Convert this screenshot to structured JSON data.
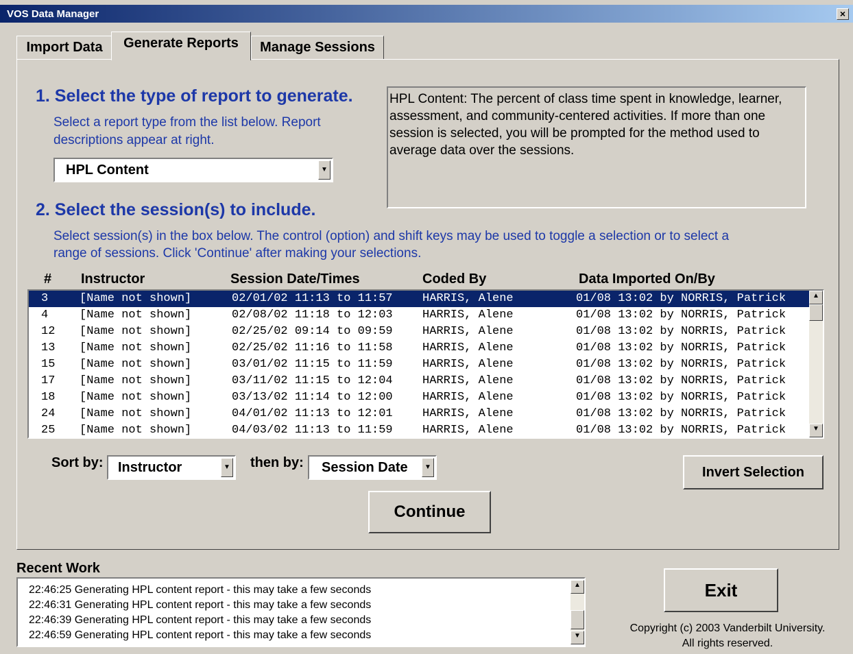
{
  "window": {
    "title": "VOS Data Manager",
    "close_label": "×"
  },
  "tabs": [
    {
      "label": "Import Data"
    },
    {
      "label": "Generate Reports"
    },
    {
      "label": "Manage Sessions"
    }
  ],
  "step1": {
    "heading": "1. Select the type of report to generate.",
    "instruction_line1": "Select a report type from the list below.  Report",
    "instruction_line2": "descriptions appear at right.",
    "report_type_selected": "HPL Content"
  },
  "description": "HPL Content: The percent of class time spent in knowledge, learner, assessment, and community-centered activities.  If more than one session is selected, you will be prompted for the method used to average data over the sessions.",
  "step2": {
    "heading": "2. Select the session(s) to include.",
    "instruction_line1": "Select session(s) in the box below.  The control (option) and shift keys may be used to toggle a selection or to select a",
    "instruction_line2": "range of sessions.  Click 'Continue' after making your selections."
  },
  "session_table": {
    "columns": [
      "#",
      "Instructor",
      "Session Date/Times",
      "Coded By",
      "Data Imported On/By"
    ],
    "rows": [
      {
        "num": "3",
        "instructor": "[Name not shown]",
        "datetime": "02/01/02 11:13 to 11:57",
        "coded_by": "HARRIS, Alene",
        "imported": "01/08 13:02 by NORRIS, Patrick",
        "selected": true
      },
      {
        "num": "4",
        "instructor": "[Name not shown]",
        "datetime": "02/08/02 11:18 to 12:03",
        "coded_by": "HARRIS, Alene",
        "imported": "01/08 13:02 by NORRIS, Patrick",
        "selected": false
      },
      {
        "num": "12",
        "instructor": "[Name not shown]",
        "datetime": "02/25/02 09:14 to 09:59",
        "coded_by": "HARRIS, Alene",
        "imported": "01/08 13:02 by NORRIS, Patrick",
        "selected": false
      },
      {
        "num": "13",
        "instructor": "[Name not shown]",
        "datetime": "02/25/02 11:16 to 11:58",
        "coded_by": "HARRIS, Alene",
        "imported": "01/08 13:02 by NORRIS, Patrick",
        "selected": false
      },
      {
        "num": "15",
        "instructor": "[Name not shown]",
        "datetime": "03/01/02 11:15 to 11:59",
        "coded_by": "HARRIS, Alene",
        "imported": "01/08 13:02 by NORRIS, Patrick",
        "selected": false
      },
      {
        "num": "17",
        "instructor": "[Name not shown]",
        "datetime": "03/11/02 11:15 to 12:04",
        "coded_by": "HARRIS, Alene",
        "imported": "01/08 13:02 by NORRIS, Patrick",
        "selected": false
      },
      {
        "num": "18",
        "instructor": "[Name not shown]",
        "datetime": "03/13/02 11:14 to 12:00",
        "coded_by": "HARRIS, Alene",
        "imported": "01/08 13:02 by NORRIS, Patrick",
        "selected": false
      },
      {
        "num": "24",
        "instructor": "[Name not shown]",
        "datetime": "04/01/02 11:13 to 12:01",
        "coded_by": "HARRIS, Alene",
        "imported": "01/08 13:02 by NORRIS, Patrick",
        "selected": false
      },
      {
        "num": "25",
        "instructor": "[Name not shown]",
        "datetime": "04/03/02 11:13 to 11:59",
        "coded_by": "HARRIS, Alene",
        "imported": "01/08 13:02 by NORRIS, Patrick",
        "selected": false
      }
    ]
  },
  "sort": {
    "sort_by_label": "Sort by:",
    "sort_by_value": "Instructor",
    "then_by_label": "then by:",
    "then_by_value": "Session Date"
  },
  "buttons": {
    "invert_selection": "Invert Selection",
    "continue": "Continue",
    "exit": "Exit"
  },
  "recent_work": {
    "label": "Recent Work",
    "entries": [
      "22:46:25 Generating HPL content report - this may take a few seconds",
      "22:46:31 Generating HPL content report - this may take a few seconds",
      "22:46:39 Generating HPL content report - this may take a few seconds",
      "22:46:59 Generating HPL content report - this may take a few seconds"
    ]
  },
  "copyright": {
    "line1": "Copyright (c) 2003 Vanderbilt University.",
    "line2": "All rights reserved."
  },
  "colors": {
    "title_bar_start": "#0a246a",
    "title_bar_end": "#a6caf0",
    "heading_blue": "#1d38a8",
    "selection": "#0a246a",
    "face": "#d4d0c8"
  }
}
